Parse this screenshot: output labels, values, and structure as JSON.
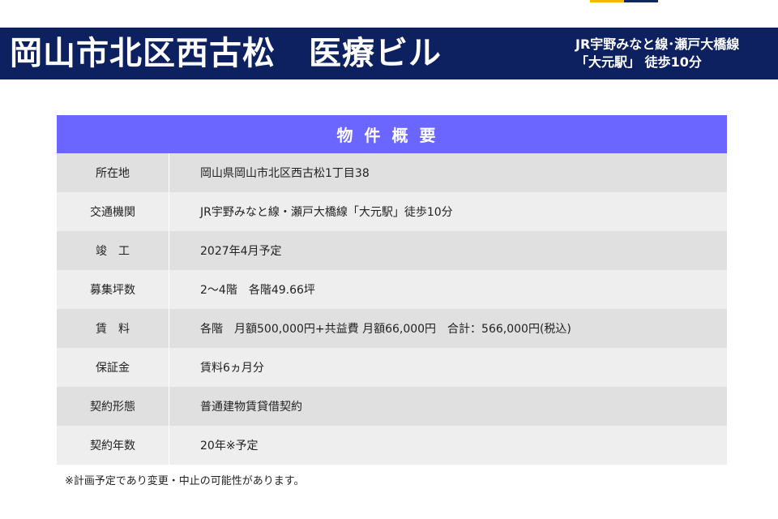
{
  "header": {
    "title": "岡山市北区西古松　医療ビル",
    "access_line1": "JR宇野みなと線･瀬戸大橋線",
    "access_line2": "「大元駅」 徒歩10分"
  },
  "colors": {
    "header_bg": "#0d2060",
    "table_head_bg": "#6a66ff",
    "row_dark": "#e0e0e0",
    "row_light": "#eeeeee",
    "accent_yellow": "#f5b800"
  },
  "table": {
    "heading": "物件概要",
    "rows": [
      {
        "label": "所在地",
        "value": "岡山県岡山市北区西古松1丁目38"
      },
      {
        "label": "交通機関",
        "value": "JR宇野みなと線・瀬戸大橋線「大元駅」徒歩10分"
      },
      {
        "label": "竣　工",
        "value": "2027年4月予定"
      },
      {
        "label": "募集坪数",
        "value": "2～4階　各階49.66坪"
      },
      {
        "label": "賃　料",
        "value": "各階　月額500,000円+共益費 月額66,000円　合計：566,000円(税込)"
      },
      {
        "label": "保証金",
        "value": "賃料6ヵ月分"
      },
      {
        "label": "契約形態",
        "value": "普通建物賃貸借契約"
      },
      {
        "label": "契約年数",
        "value": "20年※予定"
      }
    ]
  },
  "note": "※計画予定であり変更・中止の可能性があります。"
}
